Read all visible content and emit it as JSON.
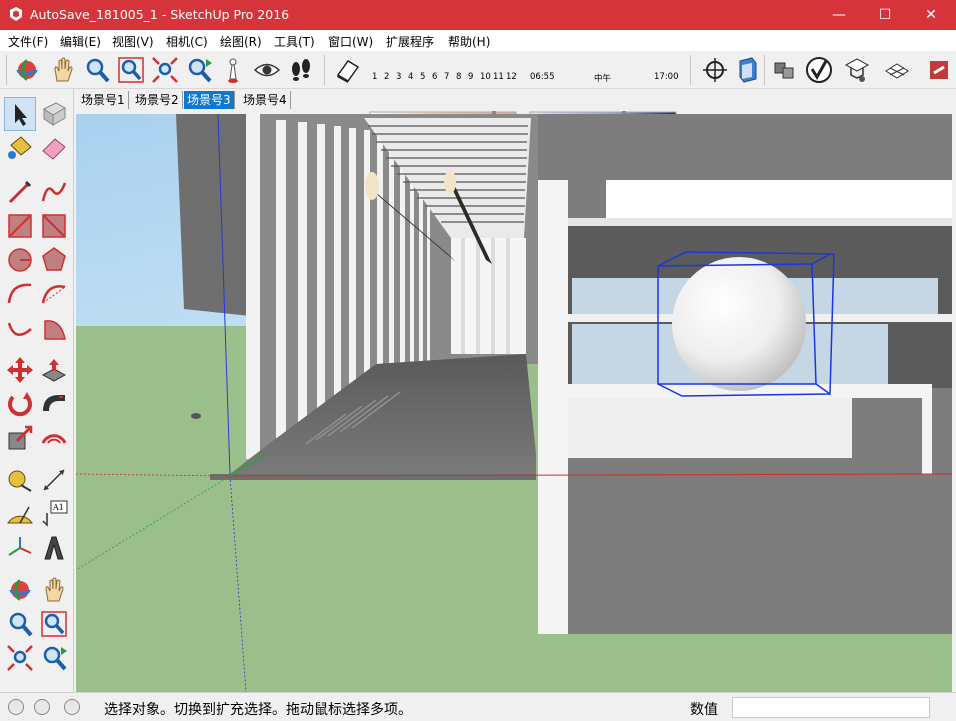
{
  "window": {
    "title": "AutoSave_181005_1 - SketchUp Pro 2016",
    "controls": {
      "minimize": "—",
      "maximize": "☐",
      "close": "✕"
    }
  },
  "menu": {
    "items": [
      "文件(F)",
      "编辑(E)",
      "视图(V)",
      "相机(C)",
      "绘图(R)",
      "工具(T)",
      "窗口(W)",
      "扩展程序",
      "帮助(H)"
    ]
  },
  "toolbar": {
    "icons": [
      "orbit-icon",
      "pan-icon",
      "zoom-icon",
      "zoom-window-icon",
      "zoom-extents-icon",
      "previous-view-icon",
      "position-camera-icon",
      "look-around-icon",
      "walk-icon",
      "shadows-icon"
    ],
    "shadow_scale": {
      "ticks": [
        "1",
        "2",
        "3",
        "4",
        "5",
        "6",
        "7",
        "8",
        "9",
        "10",
        "11",
        "12"
      ]
    },
    "time_scale": {
      "start": "06:55",
      "mid": "中午",
      "end": "17:00"
    },
    "right_icons": [
      "section-plane-icon",
      "model-info-icon",
      "components-icon",
      "validate-icon",
      "warehouse-icon",
      "extension-icon",
      "layout-icon"
    ]
  },
  "tabs": {
    "items": [
      "场景号1",
      "场景号2",
      "场景号3",
      "场景号4"
    ],
    "active_index": 2
  },
  "lefttools": {
    "icons": [
      "select-icon",
      "component-icon",
      "paint-bucket-icon",
      "eraser-icon",
      "line-icon",
      "freehand-icon",
      "rectangle-icon",
      "rotated-rectangle-icon",
      "circle-icon",
      "polygon-icon",
      "arc-icon",
      "two-point-arc-icon",
      "three-point-arc-icon",
      "pie-icon",
      "move-icon",
      "push-pull-icon",
      "rotate-icon",
      "follow-me-icon",
      "scale-icon",
      "offset-icon",
      "tape-measure-icon",
      "dimension-icon",
      "protractor-icon",
      "text-icon",
      "axes-icon",
      "3d-text-icon",
      "orbit-icon",
      "pan-icon",
      "zoom-icon",
      "zoom-window-icon",
      "zoom-extents-icon",
      "previous-icon"
    ]
  },
  "status": {
    "message": "选择对象。切换到扩充选择。拖动鼠标选择多项。",
    "value_label": "数值",
    "value": ""
  },
  "colors": {
    "titlebar": "#d6343b",
    "tab_active": "#0f79d0",
    "sky": "#9ec9ec",
    "ground": "#9bbf8b"
  }
}
